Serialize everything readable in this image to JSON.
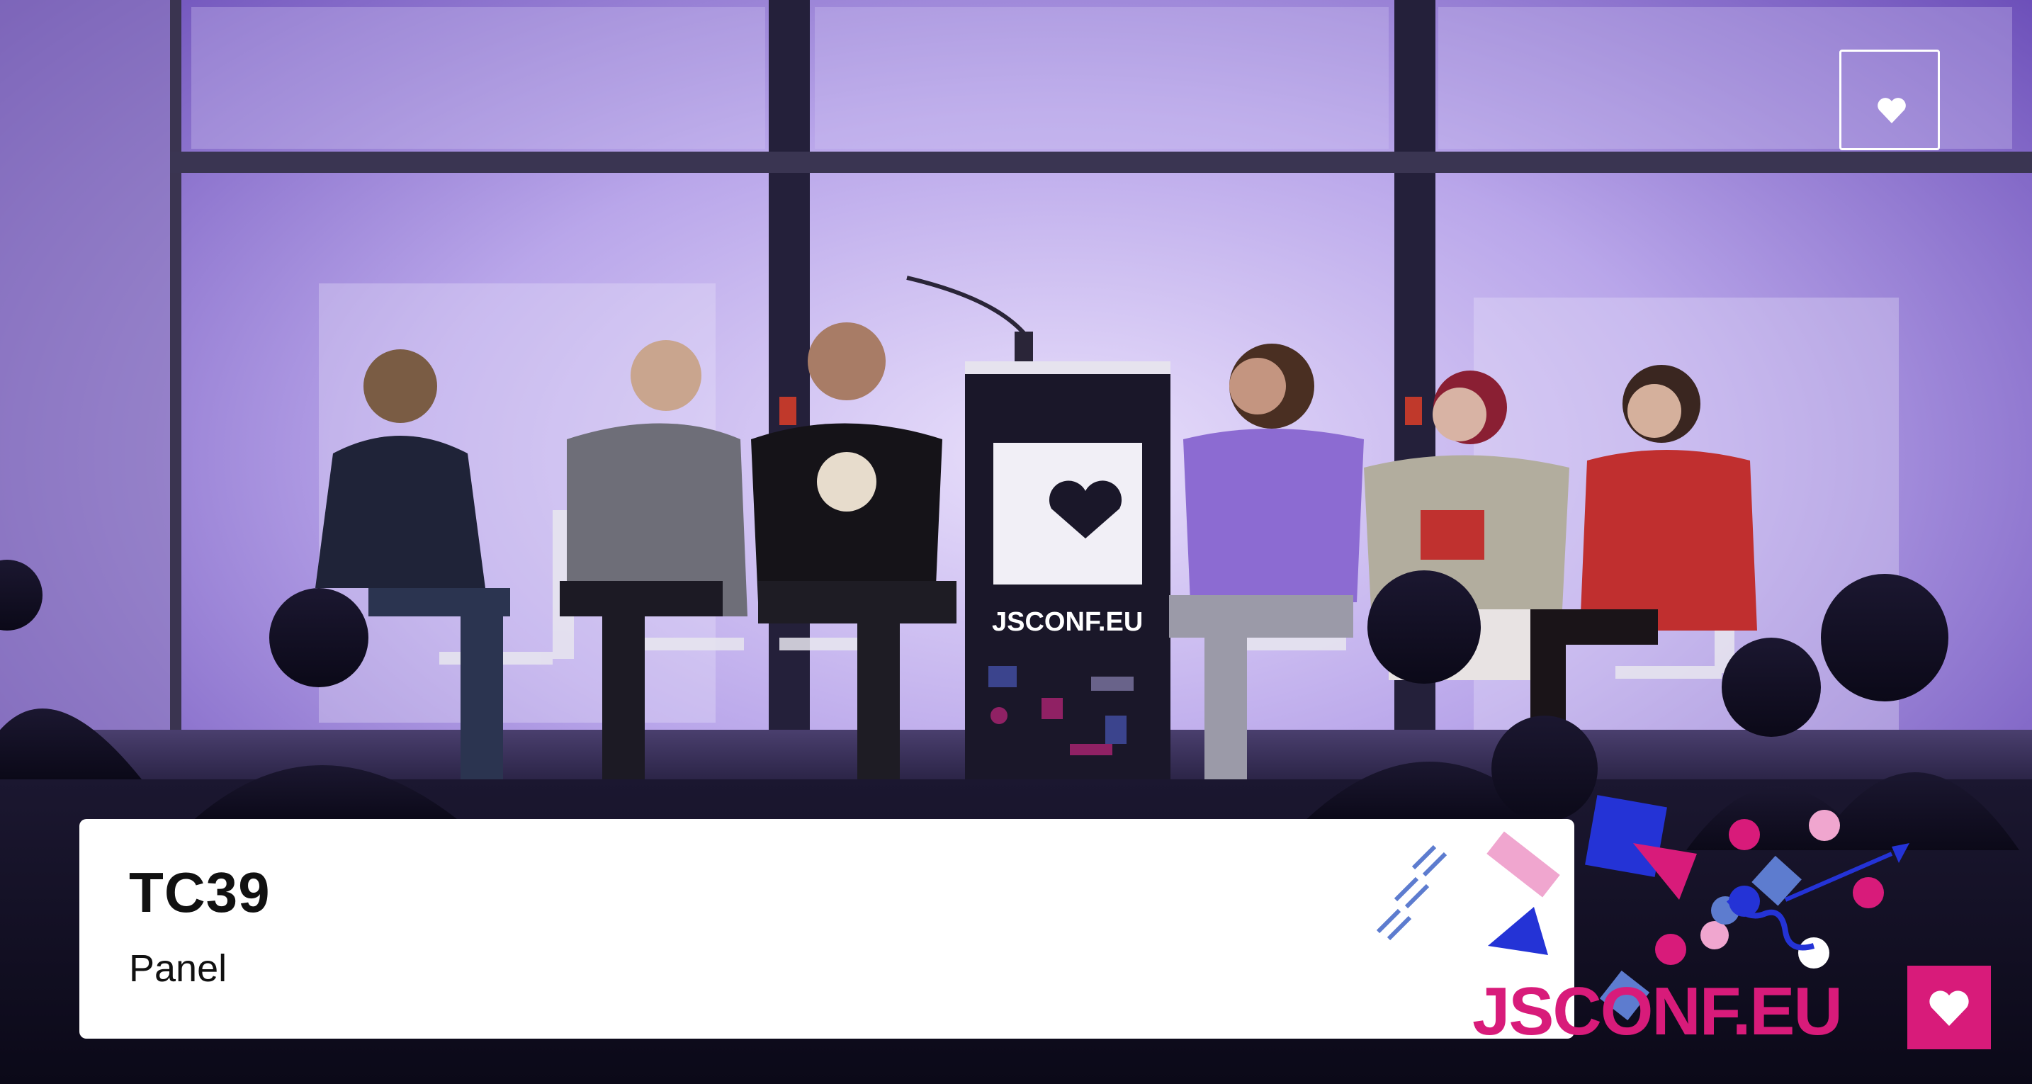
{
  "video": {
    "talk_title": "TC39",
    "talk_subtitle": "Panel",
    "podium_wordmark": "JSCONF.EU",
    "brand_wordmark": "JSCONF.EU"
  },
  "icons": {
    "corner_logo": "heart-icon",
    "brand_mark": "heart-icon"
  },
  "colors": {
    "stage_backdrop": "#b9a6ea",
    "overlay_panel": "#ffffff",
    "brand_pink": "#d81b7a",
    "brand_blue": "#2433d6",
    "brand_light_pink": "#f0a6cf",
    "brand_steel_blue": "#5d7ccf"
  }
}
